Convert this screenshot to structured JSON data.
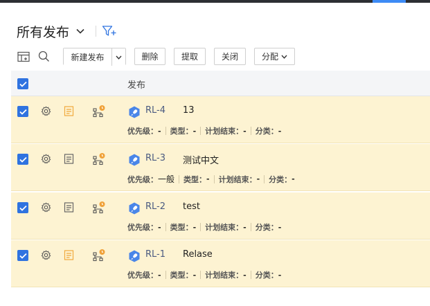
{
  "header": {
    "title": "所有发布",
    "icons": {
      "dropdown": "chevron-down-icon",
      "filter": "filter-add-icon"
    }
  },
  "toolbar": {
    "icons": {
      "columns": "table-columns-icon",
      "search": "search-icon"
    },
    "new_release": "新建发布",
    "delete": "删除",
    "extract": "提取",
    "close": "关闭",
    "assign": "分配"
  },
  "table": {
    "column_header": "发布",
    "meta_labels": {
      "priority": "优先级：",
      "type": "类型：",
      "planned_end": "计划结束：",
      "category": "分类："
    },
    "rows": [
      {
        "id": "RL-4",
        "name": "13",
        "priority": "-",
        "type": "-",
        "planned_end": "-",
        "category": "-",
        "note_highlight": true
      },
      {
        "id": "RL-3",
        "name": "测试中文",
        "priority": "一般",
        "type": "-",
        "planned_end": "-",
        "category": "-",
        "note_highlight": false
      },
      {
        "id": "RL-2",
        "name": "test",
        "priority": "-",
        "type": "-",
        "planned_end": "-",
        "category": "-",
        "note_highlight": false
      },
      {
        "id": "RL-1",
        "name": "Relase",
        "priority": "-",
        "type": "-",
        "planned_end": "-",
        "category": "-",
        "note_highlight": true
      }
    ]
  },
  "colors": {
    "accent": "#2f73e0",
    "row_selected": "#fdf3d2",
    "note_highlight": "#f0a93c",
    "badge_orange": "#f0a23a",
    "release_icon": "#4a86e8"
  }
}
